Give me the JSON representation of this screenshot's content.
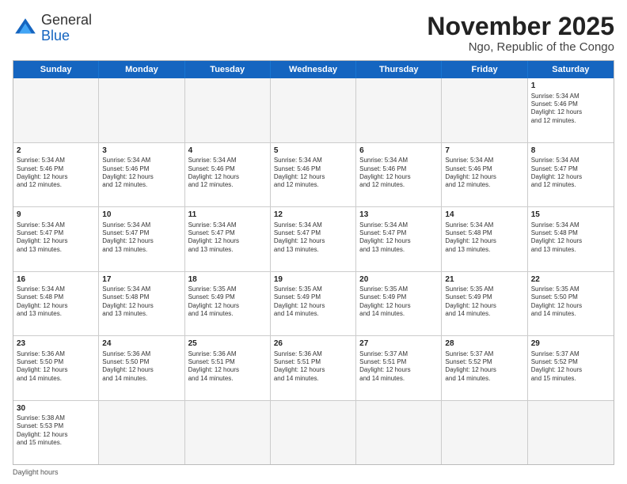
{
  "header": {
    "logo_general": "General",
    "logo_blue": "Blue",
    "title": "November 2025",
    "subtitle": "Ngo, Republic of the Congo"
  },
  "days": [
    "Sunday",
    "Monday",
    "Tuesday",
    "Wednesday",
    "Thursday",
    "Friday",
    "Saturday"
  ],
  "footer": "Daylight hours",
  "weeks": [
    [
      {
        "day": "",
        "info": ""
      },
      {
        "day": "",
        "info": ""
      },
      {
        "day": "",
        "info": ""
      },
      {
        "day": "",
        "info": ""
      },
      {
        "day": "",
        "info": ""
      },
      {
        "day": "",
        "info": ""
      },
      {
        "day": "1",
        "info": "Sunrise: 5:34 AM\nSunset: 5:46 PM\nDaylight: 12 hours\nand 12 minutes."
      }
    ],
    [
      {
        "day": "2",
        "info": "Sunrise: 5:34 AM\nSunset: 5:46 PM\nDaylight: 12 hours\nand 12 minutes."
      },
      {
        "day": "3",
        "info": "Sunrise: 5:34 AM\nSunset: 5:46 PM\nDaylight: 12 hours\nand 12 minutes."
      },
      {
        "day": "4",
        "info": "Sunrise: 5:34 AM\nSunset: 5:46 PM\nDaylight: 12 hours\nand 12 minutes."
      },
      {
        "day": "5",
        "info": "Sunrise: 5:34 AM\nSunset: 5:46 PM\nDaylight: 12 hours\nand 12 minutes."
      },
      {
        "day": "6",
        "info": "Sunrise: 5:34 AM\nSunset: 5:46 PM\nDaylight: 12 hours\nand 12 minutes."
      },
      {
        "day": "7",
        "info": "Sunrise: 5:34 AM\nSunset: 5:46 PM\nDaylight: 12 hours\nand 12 minutes."
      },
      {
        "day": "8",
        "info": "Sunrise: 5:34 AM\nSunset: 5:47 PM\nDaylight: 12 hours\nand 12 minutes."
      }
    ],
    [
      {
        "day": "9",
        "info": "Sunrise: 5:34 AM\nSunset: 5:47 PM\nDaylight: 12 hours\nand 13 minutes."
      },
      {
        "day": "10",
        "info": "Sunrise: 5:34 AM\nSunset: 5:47 PM\nDaylight: 12 hours\nand 13 minutes."
      },
      {
        "day": "11",
        "info": "Sunrise: 5:34 AM\nSunset: 5:47 PM\nDaylight: 12 hours\nand 13 minutes."
      },
      {
        "day": "12",
        "info": "Sunrise: 5:34 AM\nSunset: 5:47 PM\nDaylight: 12 hours\nand 13 minutes."
      },
      {
        "day": "13",
        "info": "Sunrise: 5:34 AM\nSunset: 5:47 PM\nDaylight: 12 hours\nand 13 minutes."
      },
      {
        "day": "14",
        "info": "Sunrise: 5:34 AM\nSunset: 5:48 PM\nDaylight: 12 hours\nand 13 minutes."
      },
      {
        "day": "15",
        "info": "Sunrise: 5:34 AM\nSunset: 5:48 PM\nDaylight: 12 hours\nand 13 minutes."
      }
    ],
    [
      {
        "day": "16",
        "info": "Sunrise: 5:34 AM\nSunset: 5:48 PM\nDaylight: 12 hours\nand 13 minutes."
      },
      {
        "day": "17",
        "info": "Sunrise: 5:34 AM\nSunset: 5:48 PM\nDaylight: 12 hours\nand 13 minutes."
      },
      {
        "day": "18",
        "info": "Sunrise: 5:35 AM\nSunset: 5:49 PM\nDaylight: 12 hours\nand 14 minutes."
      },
      {
        "day": "19",
        "info": "Sunrise: 5:35 AM\nSunset: 5:49 PM\nDaylight: 12 hours\nand 14 minutes."
      },
      {
        "day": "20",
        "info": "Sunrise: 5:35 AM\nSunset: 5:49 PM\nDaylight: 12 hours\nand 14 minutes."
      },
      {
        "day": "21",
        "info": "Sunrise: 5:35 AM\nSunset: 5:49 PM\nDaylight: 12 hours\nand 14 minutes."
      },
      {
        "day": "22",
        "info": "Sunrise: 5:35 AM\nSunset: 5:50 PM\nDaylight: 12 hours\nand 14 minutes."
      }
    ],
    [
      {
        "day": "23",
        "info": "Sunrise: 5:36 AM\nSunset: 5:50 PM\nDaylight: 12 hours\nand 14 minutes."
      },
      {
        "day": "24",
        "info": "Sunrise: 5:36 AM\nSunset: 5:50 PM\nDaylight: 12 hours\nand 14 minutes."
      },
      {
        "day": "25",
        "info": "Sunrise: 5:36 AM\nSunset: 5:51 PM\nDaylight: 12 hours\nand 14 minutes."
      },
      {
        "day": "26",
        "info": "Sunrise: 5:36 AM\nSunset: 5:51 PM\nDaylight: 12 hours\nand 14 minutes."
      },
      {
        "day": "27",
        "info": "Sunrise: 5:37 AM\nSunset: 5:51 PM\nDaylight: 12 hours\nand 14 minutes."
      },
      {
        "day": "28",
        "info": "Sunrise: 5:37 AM\nSunset: 5:52 PM\nDaylight: 12 hours\nand 14 minutes."
      },
      {
        "day": "29",
        "info": "Sunrise: 5:37 AM\nSunset: 5:52 PM\nDaylight: 12 hours\nand 15 minutes."
      }
    ],
    [
      {
        "day": "30",
        "info": "Sunrise: 5:38 AM\nSunset: 5:53 PM\nDaylight: 12 hours\nand 15 minutes."
      },
      {
        "day": "",
        "info": ""
      },
      {
        "day": "",
        "info": ""
      },
      {
        "day": "",
        "info": ""
      },
      {
        "day": "",
        "info": ""
      },
      {
        "day": "",
        "info": ""
      },
      {
        "day": "",
        "info": ""
      }
    ]
  ]
}
